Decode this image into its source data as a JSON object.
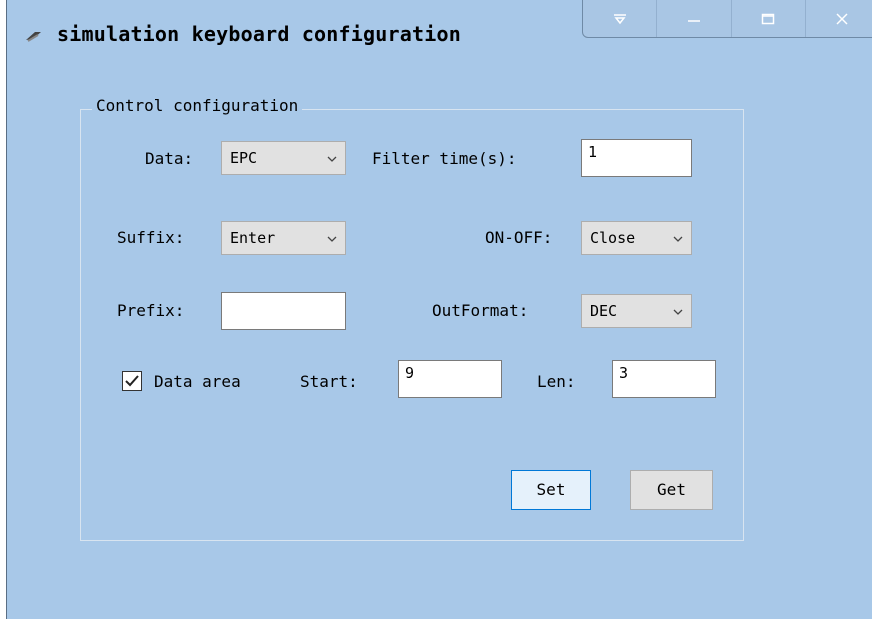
{
  "window": {
    "title": "simulation keyboard configuration",
    "icon": "app-icon",
    "caption_buttons": [
      "dropdown-icon",
      "minimize-icon",
      "maximize-icon",
      "close-icon"
    ]
  },
  "group": {
    "title": "Control configuration"
  },
  "form": {
    "data_label": "Data:",
    "data_value": "EPC",
    "filter_label": "Filter time(s):",
    "filter_value": "1",
    "suffix_label": "Suffix:",
    "suffix_value": "Enter",
    "onoff_label": "ON-OFF:",
    "onoff_value": "Close",
    "prefix_label": "Prefix:",
    "prefix_value": "",
    "outformat_label": "OutFormat:",
    "outformat_value": "DEC",
    "data_area_label": "Data area",
    "data_area_checked": true,
    "start_label": "Start:",
    "start_value": "9",
    "len_label": "Len:",
    "len_value": "3"
  },
  "buttons": {
    "set": "Set",
    "get": "Get"
  },
  "colors": {
    "window_bg": "#a8c8e8",
    "set_button_bg": "#e5f1fb",
    "set_button_border": "#0078d7",
    "get_button_bg": "#e1e1e1"
  }
}
